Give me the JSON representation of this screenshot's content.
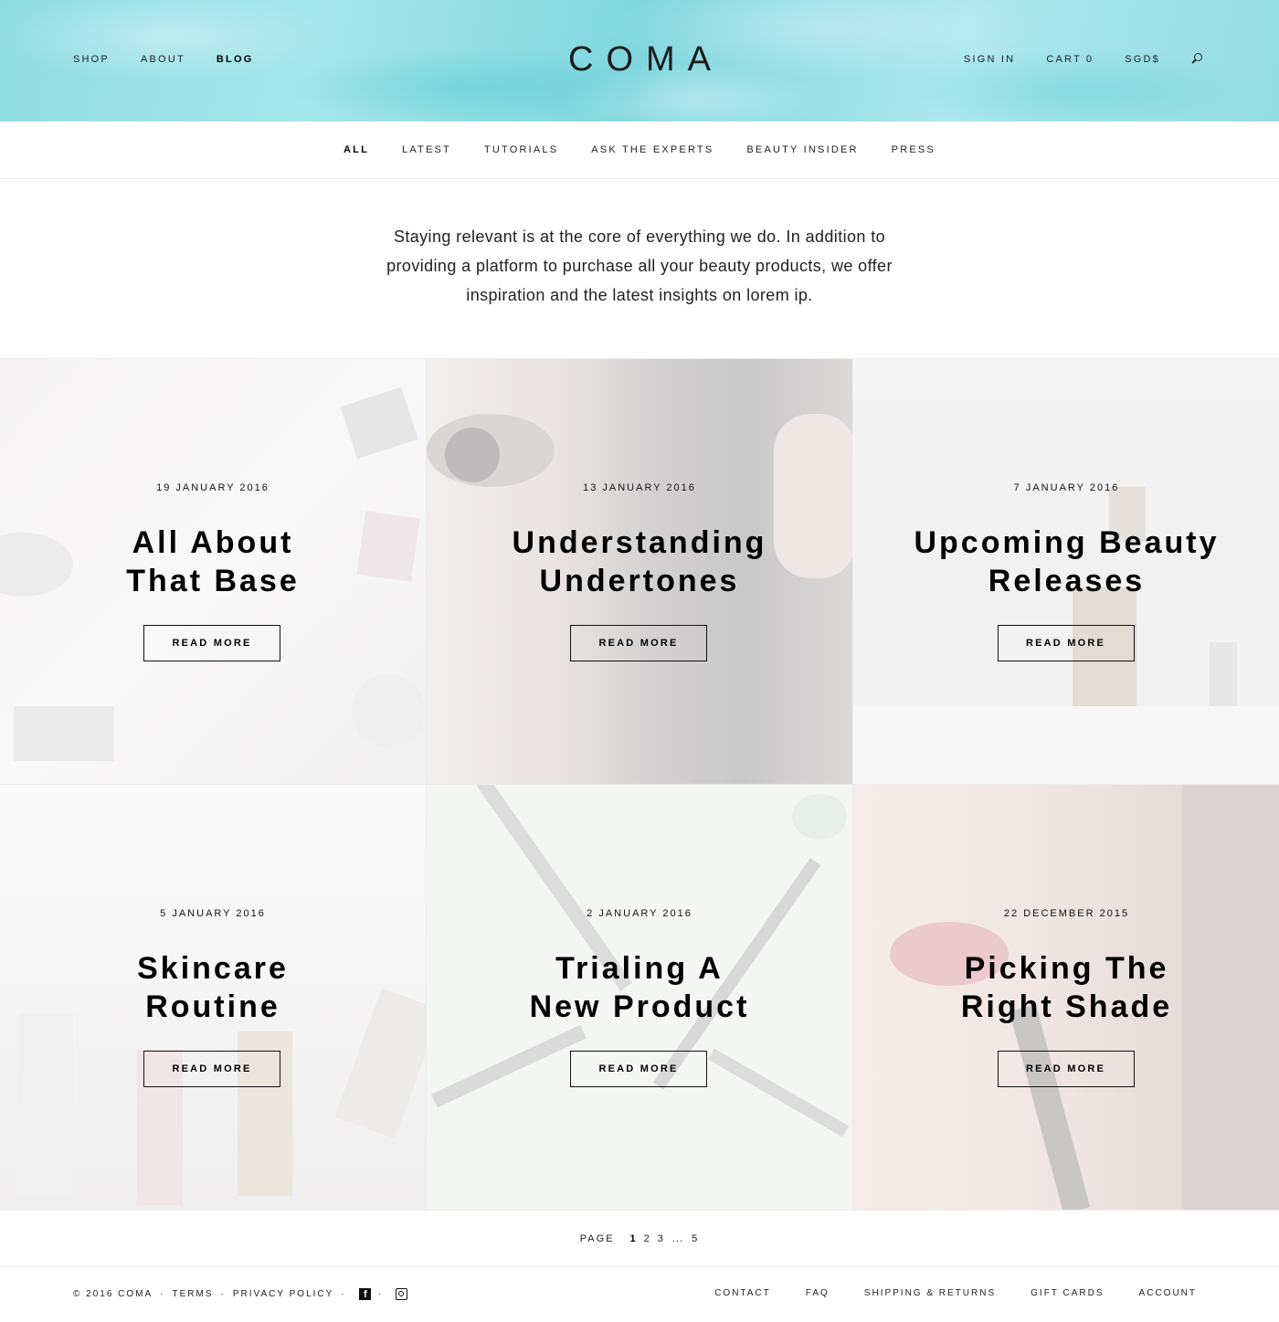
{
  "header": {
    "logo": "COMA",
    "nav_left": [
      {
        "label": "SHOP"
      },
      {
        "label": "ABOUT"
      },
      {
        "label": "BLOG"
      }
    ],
    "nav_right": [
      {
        "label": "SIGN IN"
      },
      {
        "label": "CART 0"
      },
      {
        "label": "SGD$"
      }
    ],
    "search_icon": "search-icon",
    "accent_color": "#8fdde3"
  },
  "categories": [
    {
      "label": "ALL"
    },
    {
      "label": "LATEST"
    },
    {
      "label": "TUTORIALS"
    },
    {
      "label": "ASK THE EXPERTS"
    },
    {
      "label": "BEAUTY INSIDER"
    },
    {
      "label": "PRESS"
    }
  ],
  "intro": "Staying relevant is at the core of everything we do. In addition to providing a platform to purchase all your beauty products, we offer inspiration and the latest insights on lorem ip.",
  "posts": [
    {
      "date": "19 JANUARY 2016",
      "title_line1": "All About",
      "title_line2": "That Base",
      "button": "READ MORE"
    },
    {
      "date": "13 JANUARY 2016",
      "title_line1": "Understanding",
      "title_line2": "Undertones",
      "button": "READ MORE"
    },
    {
      "date": "7 JANUARY 2016",
      "title_line1": "Upcoming Beauty",
      "title_line2": "Releases",
      "button": "READ MORE"
    },
    {
      "date": "5 JANUARY 2016",
      "title_line1": "Skincare",
      "title_line2": "Routine",
      "button": "READ MORE"
    },
    {
      "date": "2 JANUARY 2016",
      "title_line1": "Trialing A",
      "title_line2": "New Product",
      "button": "READ MORE"
    },
    {
      "date": "22 DECEMBER 2015",
      "title_line1": "Picking The",
      "title_line2": "Right Shade",
      "button": "READ MORE"
    }
  ],
  "pagination": {
    "label": "PAGE",
    "pages": [
      "1",
      "2",
      "3",
      "5"
    ],
    "ellipsis": "...",
    "current": "1"
  },
  "footer": {
    "copyright": "© 2016 COMA",
    "terms": "TERMS",
    "privacy": "PRIVACY POLICY",
    "separator": "·",
    "social_icons": [
      "facebook-icon",
      "instagram-icon"
    ],
    "links": [
      {
        "label": "CONTACT"
      },
      {
        "label": "FAQ"
      },
      {
        "label": "SHIPPING & RETURNS"
      },
      {
        "label": "GIFT CARDS"
      },
      {
        "label": "ACCOUNT"
      }
    ]
  }
}
